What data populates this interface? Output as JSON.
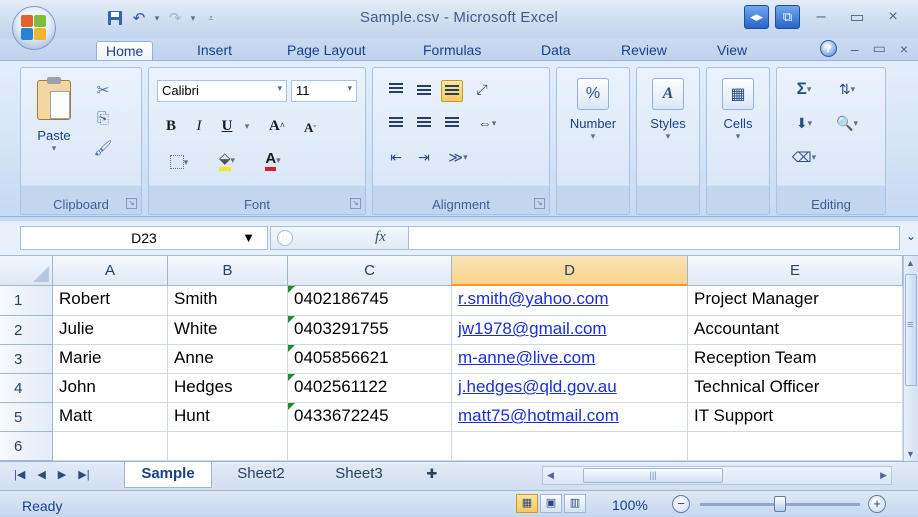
{
  "window": {
    "title": "Sample.csv - Microsoft Excel"
  },
  "ribbon_tabs": [
    "Home",
    "Insert",
    "Page Layout",
    "Formulas",
    "Data",
    "Review",
    "View"
  ],
  "ribbon": {
    "clipboard": {
      "paste_label": "Paste",
      "group_label": "Clipboard"
    },
    "font": {
      "font_name": "Calibri",
      "font_size": "11",
      "group_label": "Font",
      "bold": "B",
      "italic": "I",
      "underline": "U"
    },
    "alignment": {
      "group_label": "Alignment"
    },
    "number": {
      "label": "Number",
      "icon": "%"
    },
    "styles": {
      "label": "Styles"
    },
    "cells": {
      "label": "Cells"
    },
    "editing": {
      "group_label": "Editing",
      "sum_icon": "Σ"
    }
  },
  "formula_bar": {
    "name_box": "D23",
    "fx": "fx",
    "formula": ""
  },
  "grid": {
    "columns": [
      "A",
      "B",
      "C",
      "D",
      "E"
    ],
    "selected_column": "D",
    "rows": [
      {
        "num": "1",
        "cells": [
          "Robert",
          "Smith",
          "0402186745",
          "r.smith@yahoo.com",
          "Project Manager"
        ]
      },
      {
        "num": "2",
        "cells": [
          "Julie",
          "White",
          "0403291755",
          "jw1978@gmail.com",
          "Accountant"
        ]
      },
      {
        "num": "3",
        "cells": [
          "Marie",
          "Anne",
          "0405856621",
          "m-anne@live.com",
          "Reception Team"
        ]
      },
      {
        "num": "4",
        "cells": [
          "John",
          "Hedges",
          "0402561122",
          "j.hedges@qld.gov.au",
          "Technical Officer"
        ]
      },
      {
        "num": "5",
        "cells": [
          "Matt",
          "Hunt",
          "0433672245",
          "matt75@hotmail.com",
          "IT Support"
        ]
      },
      {
        "num": "6",
        "cells": [
          "",
          "",
          "",
          "",
          ""
        ]
      }
    ]
  },
  "sheets": [
    "Sample",
    "Sheet2",
    "Sheet3"
  ],
  "active_sheet": "Sample",
  "status": {
    "ready": "Ready",
    "zoom": "100%"
  },
  "colors": {
    "link": "#1a2fd1",
    "selected_header": "#f8d38d",
    "number_flag": "#1f8a3b"
  }
}
